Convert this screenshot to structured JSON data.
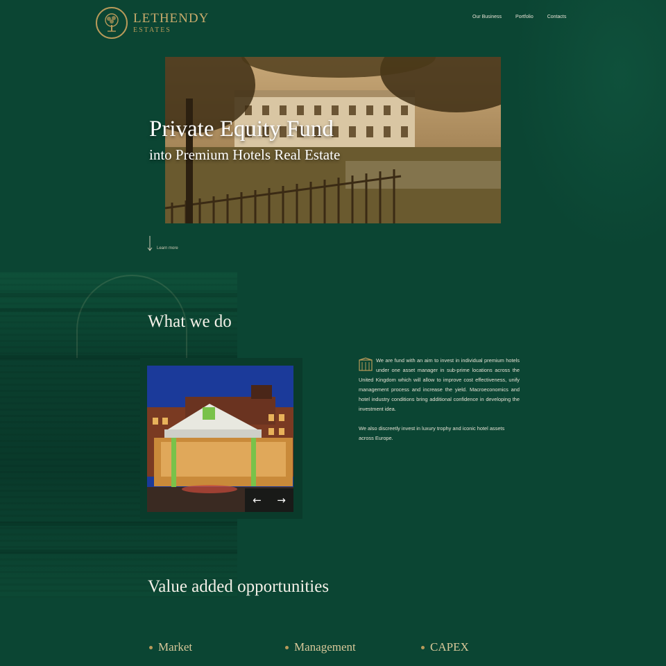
{
  "brand": {
    "name": "LETHENDY",
    "tagline": "ESTATES"
  },
  "nav": [
    "Our Business",
    "Portfolio",
    "Contacts"
  ],
  "hero": {
    "title": "Private Equity Fund",
    "subtitle": "into Premium Hotels Real Estate",
    "learn_more": "Learn more"
  },
  "what_we_do": {
    "title": "What we do",
    "paragraph1": "We are fund with an aim to invest in individual premium hotels under one asset manager in sub-prime locations across the United Kingdom which will allow to improve cost effectiveness, unify management process and increase the yield. Macroeconomics and hotel industry conditions bring additional confidence in developing the investment idea.",
    "paragraph2": "We also discreetly invest in luxury trophy and iconic hotel assets across Europe.",
    "slider_prev": "←",
    "slider_next": "→"
  },
  "value_added": {
    "title": "Value added opportunities",
    "items": [
      "Market",
      "Management",
      "CAPEX"
    ]
  },
  "colors": {
    "background": "#0b4533",
    "gold": "#b89a5a",
    "text": "#f2efe6"
  }
}
